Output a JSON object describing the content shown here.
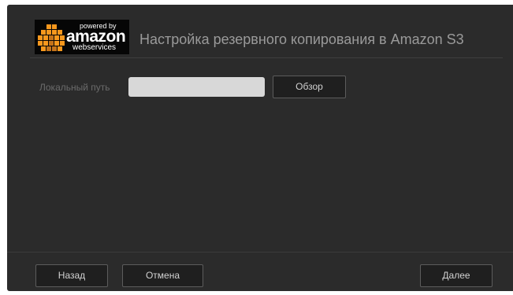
{
  "logo": {
    "powered_by": "powered by",
    "amazon": "amazon",
    "web_services": "webservices"
  },
  "header": {
    "title": "Настройка резервного копирования в Amazon S3"
  },
  "form": {
    "local_path_label": "Локальный путь",
    "local_path_value": "",
    "browse_label": "Обзор"
  },
  "footer": {
    "back_label": "Назад",
    "cancel_label": "Отмена",
    "next_label": "Далее"
  },
  "colors": {
    "dialog_background": "#2b2b2b",
    "button_background": "#1f1f1f",
    "input_background": "#d8d8d8",
    "aws_cube_orange": "#f7981d"
  },
  "icons": {
    "logo": "aws-cubes-icon"
  }
}
